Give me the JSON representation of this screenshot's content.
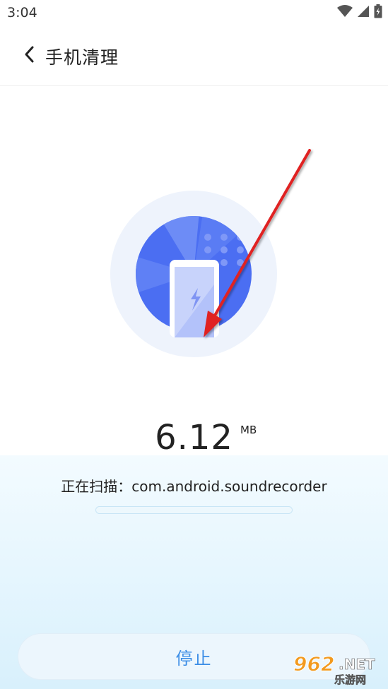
{
  "status_bar": {
    "time": "3:04"
  },
  "header": {
    "title": "手机清理"
  },
  "scan": {
    "size_value": "6.12",
    "size_unit": "MB",
    "prefix": "正在扫描：",
    "target": "com.android.soundrecorder",
    "progress": 0
  },
  "stop_button": {
    "label": "停止"
  },
  "watermark": {
    "number": "962",
    "net": ".NET",
    "cn": "乐游网"
  },
  "colors": {
    "accent": "#3b8de6",
    "circle_blue": "#4b6ef2",
    "arrow_red": "#e02020"
  },
  "icons": [
    "wifi-icon",
    "signal-icon",
    "battery-icon",
    "back-arrow-icon",
    "phone-icon"
  ]
}
